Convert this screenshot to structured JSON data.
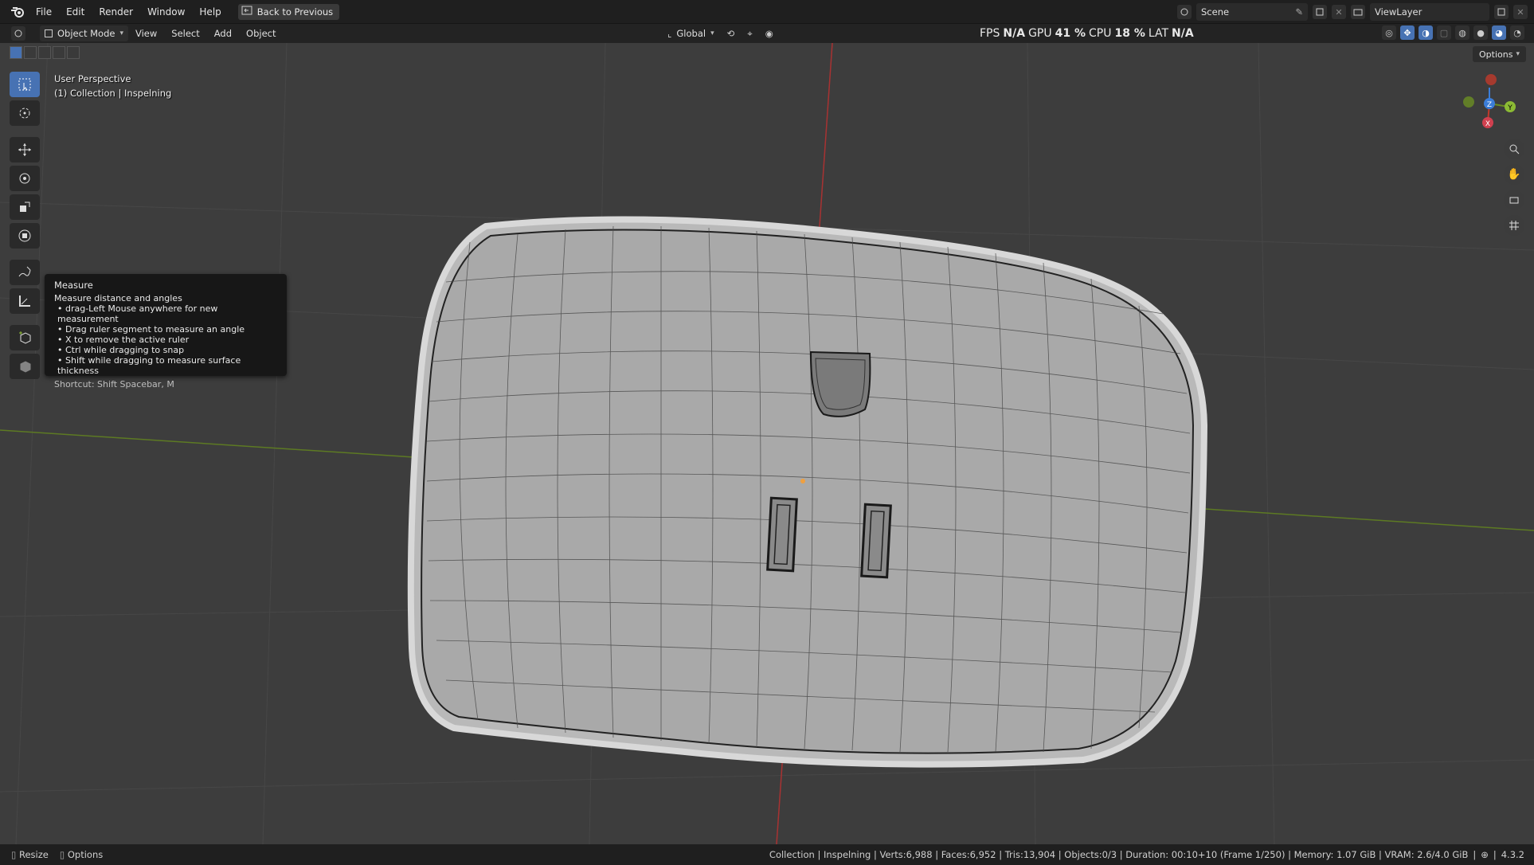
{
  "topbar": {
    "menus": [
      "File",
      "Edit",
      "Render",
      "Window",
      "Help"
    ],
    "back_button": "Back to Previous",
    "scene": "Scene",
    "view_layer": "ViewLayer"
  },
  "header": {
    "mode": "Object Mode",
    "menus": [
      "View",
      "Select",
      "Add",
      "Object"
    ],
    "orientation": "Global",
    "stats": {
      "fps_label": "FPS",
      "fps_value": "N/A",
      "gpu_label": "GPU",
      "gpu_value": "41 %",
      "cpu_label": "CPU",
      "cpu_value": "18 %",
      "lat_label": "LAT",
      "lat_value": "N/A"
    },
    "options": "Options"
  },
  "viewport": {
    "perspective": "User Perspective",
    "collection": "(1) Collection | Inspelning"
  },
  "tooltip": {
    "title": "Measure",
    "description": "Measure distance and angles",
    "lines": [
      "• drag-Left Mouse anywhere for new measurement",
      "• Drag ruler segment to measure an angle",
      "• X to remove the active ruler",
      "• Ctrl while dragging to snap",
      "• Shift while dragging to measure surface thickness"
    ],
    "shortcut": "Shortcut: Shift Spacebar, M"
  },
  "gizmo": {
    "x": "X",
    "y": "Y",
    "z": "Z"
  },
  "statusbar": {
    "left": [
      "Resize",
      "Options"
    ],
    "info": "Collection | Inspelning | Verts:6,988 | Faces:6,952 | Tris:13,904 | Objects:0/3 | Duration: 00:10+10 (Frame 1/250) | Memory: 1.07 GiB | VRAM: 2.6/4.0 GiB",
    "version": "4.3.2"
  },
  "colors": {
    "accent": "#4772b3",
    "axis_x": "#c0392b",
    "axis_y": "#6b8e23",
    "axis_z": "#3b7dd8"
  }
}
